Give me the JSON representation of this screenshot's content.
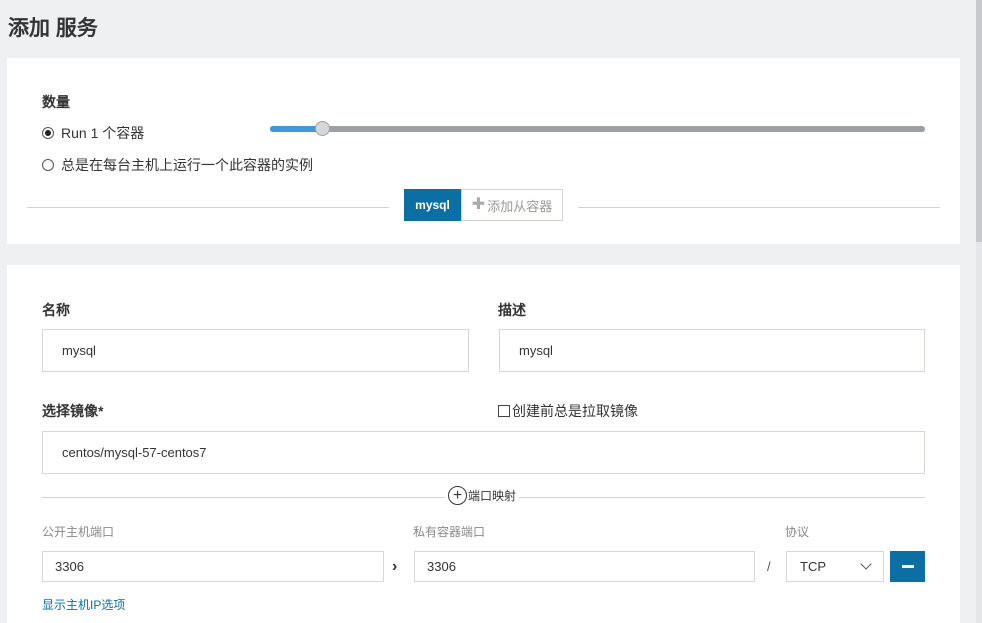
{
  "page": {
    "title": "添加 服务"
  },
  "scale": {
    "label": "数量",
    "run_option": "Run 1 个容器",
    "global_option": "总是在每台主机上运行一个此容器的实例",
    "slider_value": 1,
    "slider_fraction": 0.08
  },
  "containers": {
    "active_tab": "mysql",
    "add_sidekick": "添加从容器"
  },
  "form": {
    "name_label": "名称",
    "name_value": "mysql",
    "description_label": "描述",
    "description_value": "mysql",
    "image_label": "选择镜像*",
    "pull_checkbox_label": "创建前总是拉取镜像",
    "image_value": "centos/mysql-57-centos7"
  },
  "ports": {
    "toggle_label": "端口映射",
    "public_label": "公开主机端口",
    "private_label": "私有容器端口",
    "protocol_label": "协议",
    "public_value": "3306",
    "private_value": "3306",
    "separator": "/",
    "protocol_value": "TCP",
    "show_ip_link": "显示主机IP选项"
  },
  "colors": {
    "primary": "#0b6fa4",
    "slider_fill": "#3e98d9",
    "background": "#eef0f2"
  }
}
